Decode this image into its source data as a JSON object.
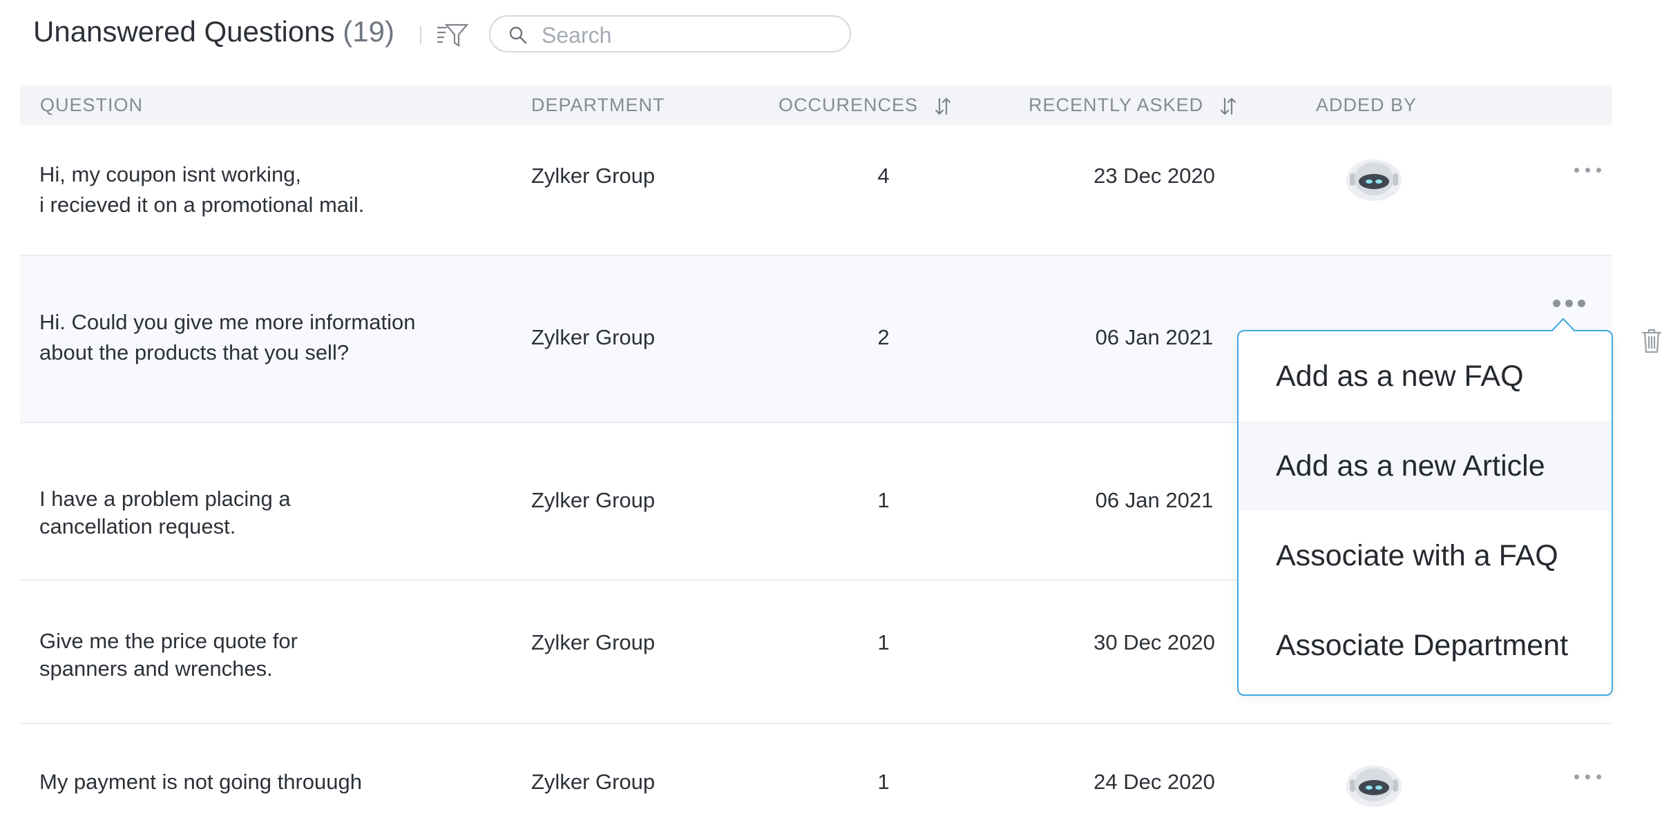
{
  "header": {
    "title": "Unanswered Questions",
    "count": "(19)"
  },
  "search": {
    "placeholder": "Search",
    "value": ""
  },
  "table": {
    "columns": {
      "question": "QUESTION",
      "department": "DEPARTMENT",
      "occurences": "OCCURENCES",
      "recently_asked": "RECENTLY ASKED",
      "added_by": "ADDED BY"
    },
    "rows": [
      {
        "question_line1": "Hi, my coupon isnt working,",
        "question_line2": "i recieved it on a promotional mail.",
        "department": "Zylker Group",
        "occurences": "4",
        "recently_asked": "23 Dec 2020",
        "added_by": "bot-avatar"
      },
      {
        "question_line1": "Hi. Could you give me more information",
        "question_line2": "about the products that you  sell?",
        "department": "Zylker Group",
        "occurences": "2",
        "recently_asked": "06 Jan 2021",
        "added_by": ""
      },
      {
        "question_line1": "I have a problem placing a",
        "question_line2": "cancellation request.",
        "department": "Zylker Group",
        "occurences": "1",
        "recently_asked": "06 Jan 2021",
        "added_by": ""
      },
      {
        "question_line1": "Give me the price quote for",
        "question_line2": "spanners and wrenches.",
        "department": "Zylker Group",
        "occurences": "1",
        "recently_asked": "30 Dec 2020",
        "added_by": ""
      },
      {
        "question_line1": "My payment is not going throuugh",
        "question_line2": "",
        "department": "Zylker Group",
        "occurences": "1",
        "recently_asked": "24 Dec 2020",
        "added_by": "bot-avatar"
      }
    ]
  },
  "context_menu": {
    "items": [
      {
        "label": "Add as a new FAQ"
      },
      {
        "label": "Add as a new Article"
      },
      {
        "label": "Associate with a FAQ"
      },
      {
        "label": "Associate Department"
      }
    ]
  },
  "icons": {
    "filter": "sort-filter-icon",
    "search": "search-icon",
    "sort": "sort-arrows-icon",
    "more": "more-options-icon",
    "trash": "trash-icon",
    "avatar": "bot-avatar-icon"
  },
  "colors": {
    "accent_border": "#3ea9e0",
    "header_bg": "#f3f4f7",
    "highlight_row": "#f8f9fc"
  }
}
